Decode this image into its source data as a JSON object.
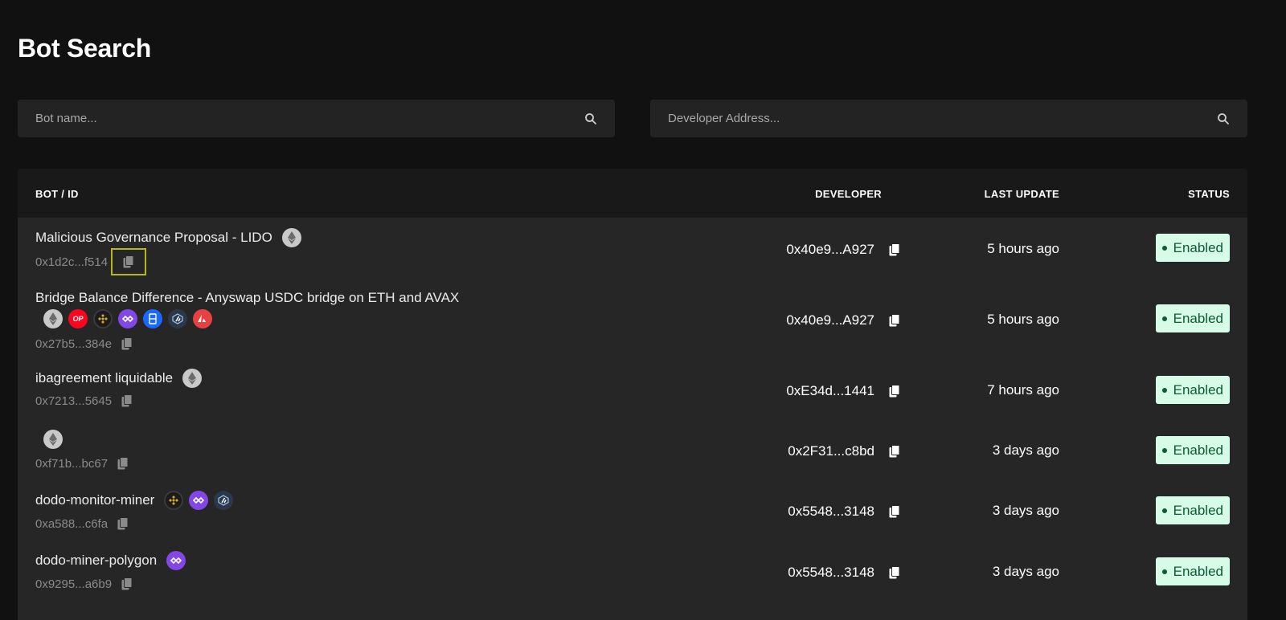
{
  "page": {
    "title": "Bot Search"
  },
  "search": {
    "bot_placeholder": "Bot name...",
    "developer_placeholder": "Developer Address..."
  },
  "table": {
    "headers": {
      "bot": "BOT / ID",
      "developer": "DEVELOPER",
      "last_update": "LAST UPDATE",
      "status": "STATUS"
    },
    "rows": [
      {
        "name": "Malicious Governance Proposal - LIDO",
        "chains": [
          "ethereum-icon"
        ],
        "id": "0x1d2c...f514",
        "developer": "0x40e9...A927",
        "last_update": "5 hours ago",
        "status": "Enabled"
      },
      {
        "name": "Bridge Balance Difference - Anyswap USDC bridge on ETH and AVAX",
        "chains": [
          "ethereum-icon",
          "optimism-icon",
          "bnb-icon",
          "polygon-icon",
          "fantom-icon",
          "arbitrum-icon",
          "avalanche-icon"
        ],
        "id": "0x27b5...384e",
        "developer": "0x40e9...A927",
        "last_update": "5 hours ago",
        "status": "Enabled"
      },
      {
        "name": "ibagreement liquidable",
        "chains": [
          "ethereum-icon"
        ],
        "id": "0x7213...5645",
        "developer": "0xE34d...1441",
        "last_update": "7 hours ago",
        "status": "Enabled"
      },
      {
        "name": "",
        "chains": [
          "ethereum-icon"
        ],
        "id": "0xf71b...bc67",
        "developer": "0x2F31...c8bd",
        "last_update": "3 days ago",
        "status": "Enabled"
      },
      {
        "name": "dodo-monitor-miner",
        "chains": [
          "bnb-icon",
          "polygon-icon",
          "arbitrum-icon"
        ],
        "id": "0xa588...c6fa",
        "developer": "0x5548...3148",
        "last_update": "3 days ago",
        "status": "Enabled"
      },
      {
        "name": "dodo-miner-polygon",
        "chains": [
          "polygon-icon"
        ],
        "id": "0x9295...a6b9",
        "developer": "0x5548...3148",
        "last_update": "3 days ago",
        "status": "Enabled"
      }
    ]
  },
  "chain_labels": {
    "optimism": "OP"
  },
  "colors": {
    "background": "#111111",
    "panel": "#232323",
    "row": "#262626",
    "status_bg": "#d6fbe6",
    "status_text": "#0c5b33",
    "highlight": "#b5b81c"
  }
}
